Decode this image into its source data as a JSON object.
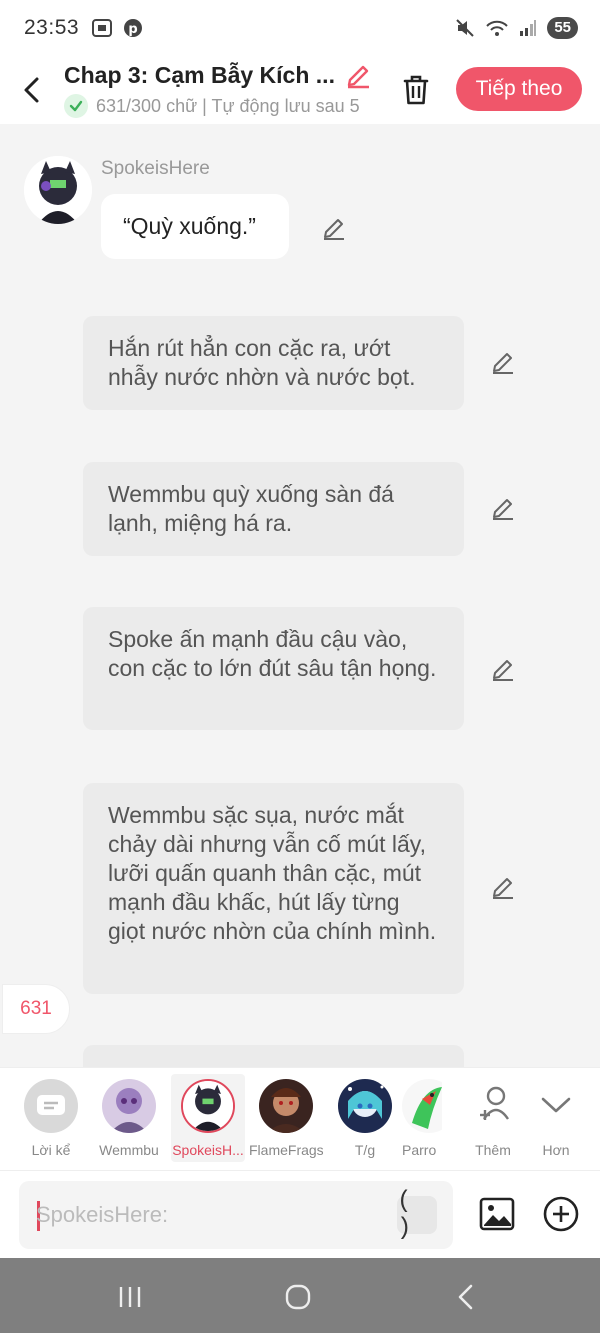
{
  "status_bar": {
    "time": "23:53",
    "battery": "55"
  },
  "header": {
    "title": "Chap 3: Cạm Bẫy Kích ...",
    "subtitle": "631/300 chữ | Tự động lưu sau 5",
    "next_label": "Tiếp theo"
  },
  "chat": {
    "speaker_name": "SpokeisHere",
    "dialogue": "“Quỳ xuống.”",
    "narrations": [
      "Hắn rút hẳn con cặc ra, ướt nhẫy nước nhờn và nước bọt.",
      "Wemmbu quỳ xuống sàn đá lạnh, miệng há ra.",
      "Spoke ấn mạnh đầu cậu vào, con cặc to lớn đút sâu tận họng.",
      "Wemmbu sặc sụa, nước mắt chảy dài nhưng vẫn cố mút lấy, lưỡi quấn quanh thân cặc, mút mạnh đầu khấc, hút lấy từng giọt nước nhờn của chính mình."
    ],
    "word_count": "631"
  },
  "characters": [
    {
      "name": "Lời kể"
    },
    {
      "name": "Wemmbu"
    },
    {
      "name": "SpokeisH..."
    },
    {
      "name": "FlameFrags"
    },
    {
      "name": "T/g"
    },
    {
      "name": "Parro"
    },
    {
      "name": "Thêm"
    },
    {
      "name": "Hơn"
    }
  ],
  "input": {
    "placeholder": "SpokeisHere:",
    "paren_label": "( )"
  },
  "colors": {
    "accent": "#f0566a",
    "accent_dark": "#e0485c",
    "narration_bg": "#ebebeb",
    "background": "#f4f4f4"
  }
}
